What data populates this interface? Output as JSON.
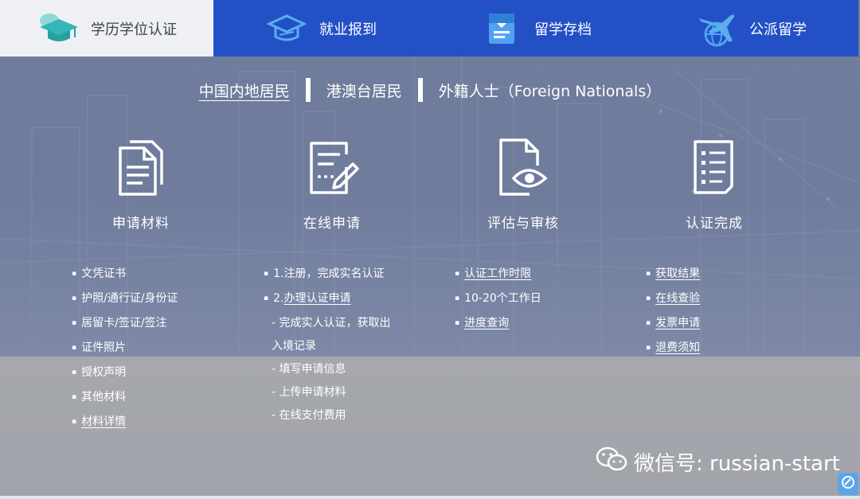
{
  "tabs": [
    {
      "label": "学历学位认证",
      "icon": "graduation-cap-icon",
      "active": true
    },
    {
      "label": "就业报到",
      "icon": "graduation-cap-outline-icon",
      "active": false
    },
    {
      "label": "留学存档",
      "icon": "document-folder-icon",
      "active": false
    },
    {
      "label": "公派留学",
      "icon": "airplane-globe-icon",
      "active": false
    }
  ],
  "regions": [
    "中国内地居民",
    "港澳台居民",
    "外籍人士（Foreign Nationals）"
  ],
  "steps": [
    {
      "title": "申请材料",
      "icon": "documents-icon"
    },
    {
      "title": "在线申请",
      "icon": "form-edit-icon"
    },
    {
      "title": "评估与审核",
      "icon": "document-eye-icon"
    },
    {
      "title": "认证完成",
      "icon": "checklist-icon"
    }
  ],
  "materials": [
    "文凭证书",
    "护照/通行证/身份证",
    "居留卡/签证/签注",
    "证件照片",
    "授权声明",
    "其他材料",
    "材料详情"
  ],
  "online": {
    "item1": "1.注册，完成实名认证",
    "item2_prefix": "2.",
    "item2_link": "办理认证申请",
    "sub1_line1": "- 完成实人认证，获取出",
    "sub1_line2": "入境记录",
    "sub2": "- 填写申请信息",
    "sub3": "- 上传申请材料",
    "sub4": "- 在线支付费用"
  },
  "review": [
    "认证工作时限",
    "10-20个工作日",
    "进度查询"
  ],
  "complete": [
    "获取结果",
    "在线查验",
    "发票申请",
    "退费须知"
  ],
  "watermark": "微信号: russian-start",
  "colors": {
    "tab_blue": "#2450c6",
    "tab_active": "#eef0f4",
    "accent_icon": "#2e8ae6"
  }
}
